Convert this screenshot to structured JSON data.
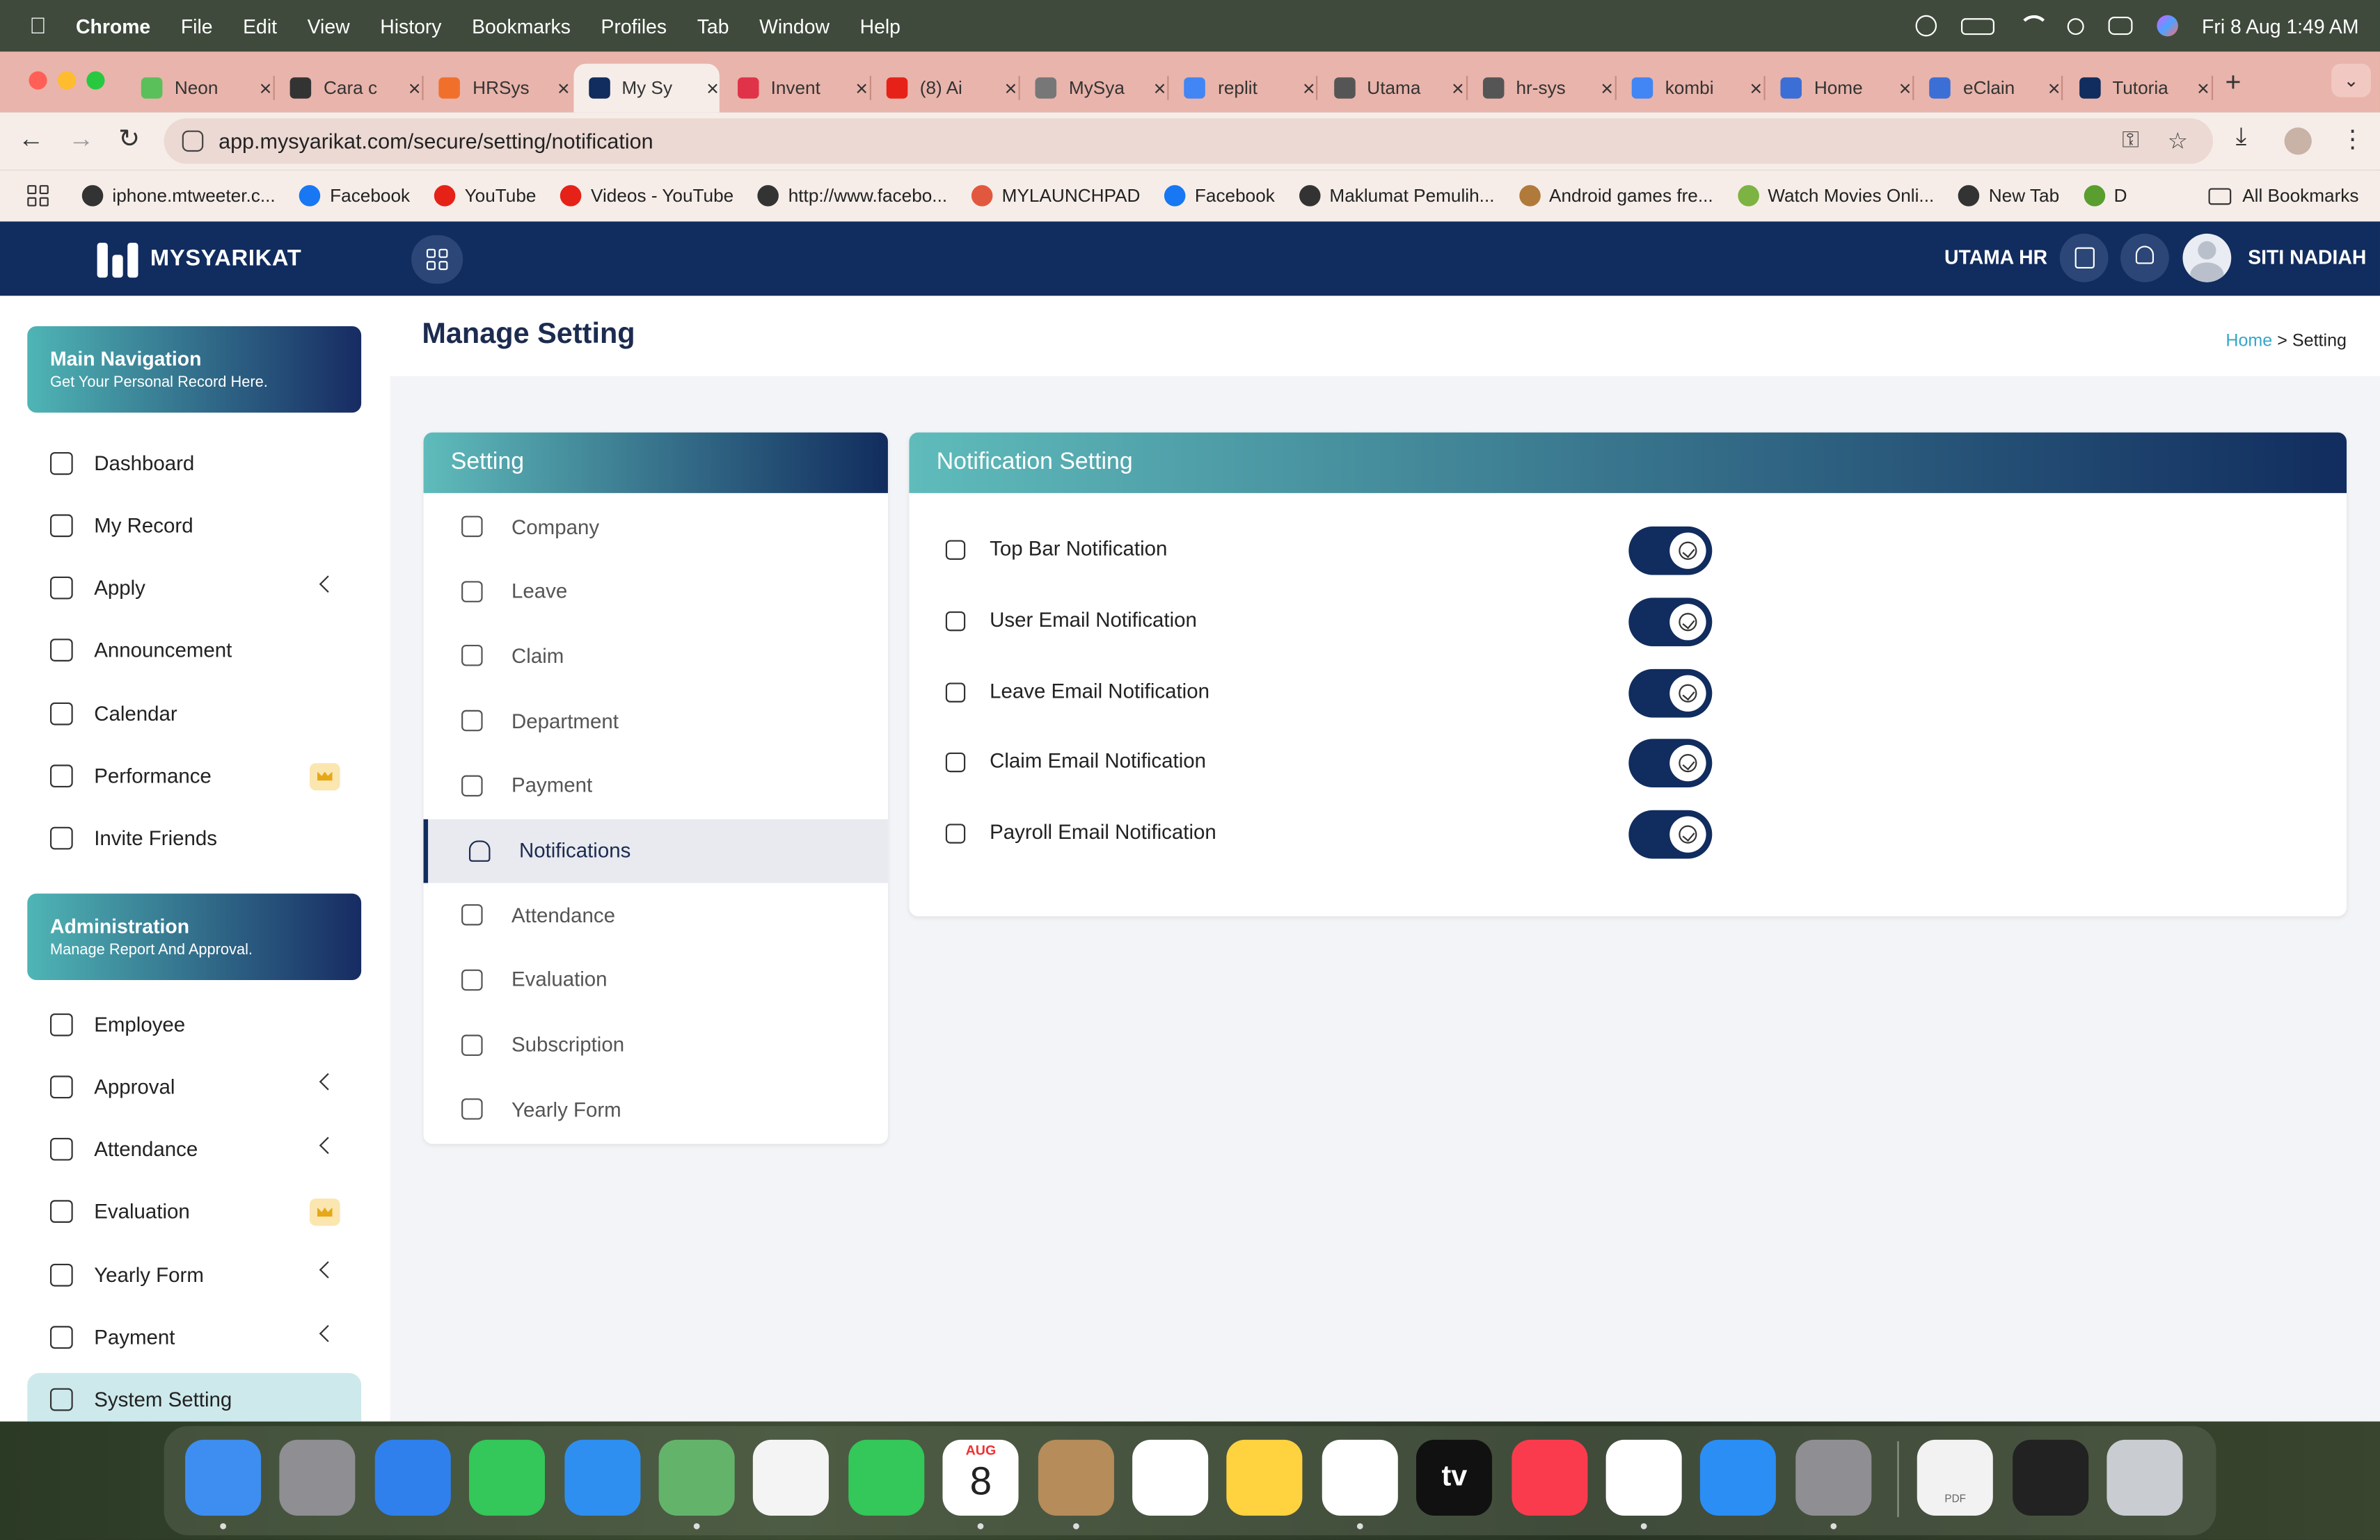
{
  "menubar": {
    "app": "Chrome",
    "items": [
      "File",
      "Edit",
      "View",
      "History",
      "Bookmarks",
      "Profiles",
      "Tab",
      "Window",
      "Help"
    ],
    "datetime": "Fri 8 Aug  1:49 AM"
  },
  "tabs": [
    {
      "label": "Neon",
      "icon": "neon-icon",
      "color": "#5ac05a"
    },
    {
      "label": "Cara c",
      "icon": "openai-icon",
      "color": "#333333"
    },
    {
      "label": "HRSys",
      "icon": "hrsys-icon",
      "color": "#f0702b"
    },
    {
      "label": "My Sy",
      "icon": "mysyarikat-icon",
      "color": "#112c5e",
      "active": true
    },
    {
      "label": "Invent",
      "icon": "heart-icon",
      "color": "#e0334a"
    },
    {
      "label": "(8) Ai",
      "icon": "youtube-icon",
      "color": "#e62117"
    },
    {
      "label": "MySya",
      "icon": "mysyarikat-icon",
      "color": "#777777"
    },
    {
      "label": "replit",
      "icon": "google-icon",
      "color": "#4285f4"
    },
    {
      "label": "Utama",
      "icon": "globe-icon",
      "color": "#555555"
    },
    {
      "label": "hr-sys",
      "icon": "globe-icon",
      "color": "#555555"
    },
    {
      "label": "kombi",
      "icon": "google-icon",
      "color": "#4285f4"
    },
    {
      "label": "Home",
      "icon": "eclaim-icon",
      "color": "#3b6fd6"
    },
    {
      "label": "eClain",
      "icon": "eclaim-icon",
      "color": "#3b6fd6"
    },
    {
      "label": "Tutoria",
      "icon": "mysyarikat-icon",
      "color": "#112c5e"
    }
  ],
  "address_bar": {
    "url": "app.mysyarikat.com/secure/setting/notification"
  },
  "bookmarks": [
    {
      "label": "iphone.mtweeter.c...",
      "icon": "globe-icon",
      "color": "#333333"
    },
    {
      "label": "Facebook",
      "icon": "facebook-icon",
      "color": "#1877f2"
    },
    {
      "label": "YouTube",
      "icon": "youtube-icon",
      "color": "#e62117"
    },
    {
      "label": "Videos - YouTube",
      "icon": "youtube-icon",
      "color": "#e62117"
    },
    {
      "label": "http://www.facebo...",
      "icon": "globe-icon",
      "color": "#333333"
    },
    {
      "label": "MYLAUNCHPAD",
      "icon": "launchpad-icon",
      "color": "#e2583e"
    },
    {
      "label": "Facebook",
      "icon": "facebook-icon",
      "color": "#1877f2"
    },
    {
      "label": "Maklumat Pemulih...",
      "icon": "globe-icon",
      "color": "#333333"
    },
    {
      "label": "Android games fre...",
      "icon": "android-icon",
      "color": "#b07a3a"
    },
    {
      "label": "Watch Movies Onli...",
      "icon": "movie-icon",
      "color": "#7cb342"
    },
    {
      "label": "New Tab",
      "icon": "globe-icon",
      "color": "#333333"
    },
    {
      "label": "D",
      "icon": "download-icon",
      "color": "#5a9e2f"
    }
  ],
  "all_bookmarks": "All Bookmarks",
  "app": {
    "brand": "MYSYARIKAT",
    "company": "UTAMA HR",
    "user": "SITI NADIAH",
    "page_title": "Manage Setting",
    "breadcrumb": {
      "home": "Home",
      "sep": ">",
      "current": "Setting"
    }
  },
  "sidebar": {
    "main_card": {
      "title": "Main Navigation",
      "subtitle": "Get Your Personal Record Here."
    },
    "main_items": [
      {
        "label": "Dashboard",
        "icon": "dashboard-icon"
      },
      {
        "label": "My Record",
        "icon": "folder-icon"
      },
      {
        "label": "Apply",
        "icon": "apply-icon",
        "chevron": true
      },
      {
        "label": "Announcement",
        "icon": "announcement-icon"
      },
      {
        "label": "Calendar",
        "icon": "calendar-icon"
      },
      {
        "label": "Performance",
        "icon": "performance-icon",
        "crown": true
      },
      {
        "label": "Invite Friends",
        "icon": "gift-icon"
      }
    ],
    "admin_card": {
      "title": "Administration",
      "subtitle": "Manage Report And Approval."
    },
    "admin_items": [
      {
        "label": "Employee",
        "icon": "users-icon"
      },
      {
        "label": "Approval",
        "icon": "check-square-icon",
        "chevron": true
      },
      {
        "label": "Attendance",
        "icon": "clock-icon",
        "chevron": true
      },
      {
        "label": "Evaluation",
        "icon": "presentation-icon",
        "crown": true
      },
      {
        "label": "Yearly Form",
        "icon": "list-icon",
        "chevron": true
      },
      {
        "label": "Payment",
        "icon": "dollar-icon",
        "chevron": true
      },
      {
        "label": "System Setting",
        "icon": "gear-icon",
        "active": true
      }
    ]
  },
  "setting_panel": {
    "title": "Setting",
    "items": [
      {
        "label": "Company",
        "icon": "building-icon"
      },
      {
        "label": "Leave",
        "icon": "calendar-check-icon"
      },
      {
        "label": "Claim",
        "icon": "wallet-icon"
      },
      {
        "label": "Department",
        "icon": "department-icon"
      },
      {
        "label": "Payment",
        "icon": "car-icon"
      },
      {
        "label": "Notifications",
        "icon": "bell-icon",
        "active": true
      },
      {
        "label": "Attendance",
        "icon": "clock-icon"
      },
      {
        "label": "Evaluation",
        "icon": "chart-icon"
      },
      {
        "label": "Subscription",
        "icon": "warning-icon"
      },
      {
        "label": "Yearly Form",
        "icon": "list-icon"
      }
    ]
  },
  "notification_panel": {
    "title": "Notification Setting",
    "rows": [
      {
        "label": "Top Bar Notification",
        "icon": "bell-icon",
        "enabled": true
      },
      {
        "label": "User Email Notification",
        "icon": "users-icon",
        "enabled": true
      },
      {
        "label": "Leave Email Notification",
        "icon": "calendar-icon",
        "enabled": true
      },
      {
        "label": "Claim Email Notification",
        "icon": "wallet-icon",
        "enabled": true
      },
      {
        "label": "Payroll Email Notification",
        "icon": "card-icon",
        "enabled": true
      }
    ]
  },
  "dock": {
    "apps": [
      {
        "name": "finder-icon",
        "color": "#3d8ef0"
      },
      {
        "name": "launchpad-icon",
        "color": "#8e8e93"
      },
      {
        "name": "safari-icon",
        "color": "#2f80ed"
      },
      {
        "name": "messages-icon",
        "color": "#34c759"
      },
      {
        "name": "mail-icon",
        "color": "#2e8ff0"
      },
      {
        "name": "maps-icon",
        "color": "#64b36b"
      },
      {
        "name": "photos-icon",
        "color": "#f4f4f4"
      },
      {
        "name": "facetime-icon",
        "color": "#34c759"
      },
      {
        "name": "calendar-icon",
        "color": "#ffffff"
      },
      {
        "name": "contacts-icon",
        "color": "#b58c5a"
      },
      {
        "name": "reminders-icon",
        "color": "#ffffff"
      },
      {
        "name": "notes-icon",
        "color": "#ffd23f"
      },
      {
        "name": "freeform-icon",
        "color": "#ffffff"
      },
      {
        "name": "tv-icon",
        "color": "#111111"
      },
      {
        "name": "music-icon",
        "color": "#fa3b4e"
      },
      {
        "name": "chrome-icon",
        "color": "#ffffff"
      },
      {
        "name": "app-store-icon",
        "color": "#2a8ef5"
      },
      {
        "name": "system-settings-icon",
        "color": "#8e8e93"
      },
      {
        "name": "pdf-document-icon",
        "color": "#f2f2f2"
      },
      {
        "name": "screenshot-icon",
        "color": "#222222"
      },
      {
        "name": "trash-icon",
        "color": "#c9cdd2"
      }
    ],
    "calendar": {
      "month": "AUG",
      "day": "8"
    },
    "tv_label": "tv",
    "pdf_label": "PDF"
  }
}
